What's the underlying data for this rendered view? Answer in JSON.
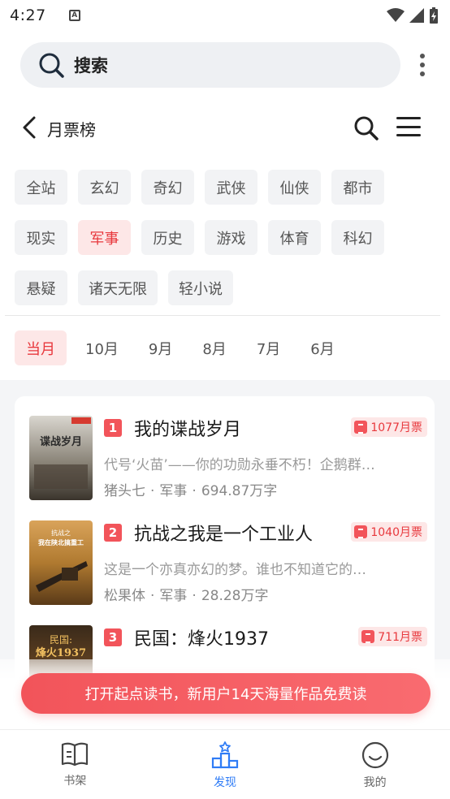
{
  "status_bar": {
    "time": "4:27",
    "notification_icon": "A"
  },
  "search": {
    "label": "搜索"
  },
  "header": {
    "title": "月票榜"
  },
  "categories": [
    [
      "全站",
      "玄幻",
      "奇幻",
      "武侠",
      "仙侠",
      "都市"
    ],
    [
      "现实",
      "军事",
      "历史",
      "游戏",
      "体育",
      "科幻"
    ],
    [
      "悬疑",
      "诸天无限",
      "轻小说"
    ]
  ],
  "active_category": "军事",
  "months": [
    "当月",
    "10月",
    "9月",
    "8月",
    "7月",
    "6月"
  ],
  "active_month": "当月",
  "books": [
    {
      "rank": "1",
      "title": "我的谍战岁月",
      "tickets": "1077月票",
      "desc": "代号‘火苗’——你的功勋永垂不朽！企鹅群…",
      "author": "猪头七",
      "genre": "军事",
      "words": "694.87万字",
      "cover_text": "谍战岁月"
    },
    {
      "rank": "2",
      "title": "抗战之我是一个工业人",
      "tickets": "1040月票",
      "desc": "这是一个亦真亦幻的梦。谁也不知道它的…",
      "author": "松果体",
      "genre": "军事",
      "words": "28.28万字",
      "cover_text": "抗战之我在陕北搞重工"
    },
    {
      "rank": "3",
      "title": "民国：烽火1937",
      "tickets": "711月票",
      "desc": "",
      "author": "",
      "genre": "",
      "words": "",
      "cover_text": "民国烽火1937"
    }
  ],
  "promo": {
    "text": "打开起点读书，新用户14天海量作品免费读"
  },
  "bottom_nav": [
    {
      "label": "书架",
      "icon": "book-icon"
    },
    {
      "label": "发现",
      "icon": "podium-icon"
    },
    {
      "label": "我的",
      "icon": "smile-icon"
    }
  ],
  "colors": {
    "accent": "#e8383d",
    "nav_active": "#2f7cf6",
    "chip_bg": "#f2f3f5",
    "chip_active_bg": "#fde7e7"
  }
}
